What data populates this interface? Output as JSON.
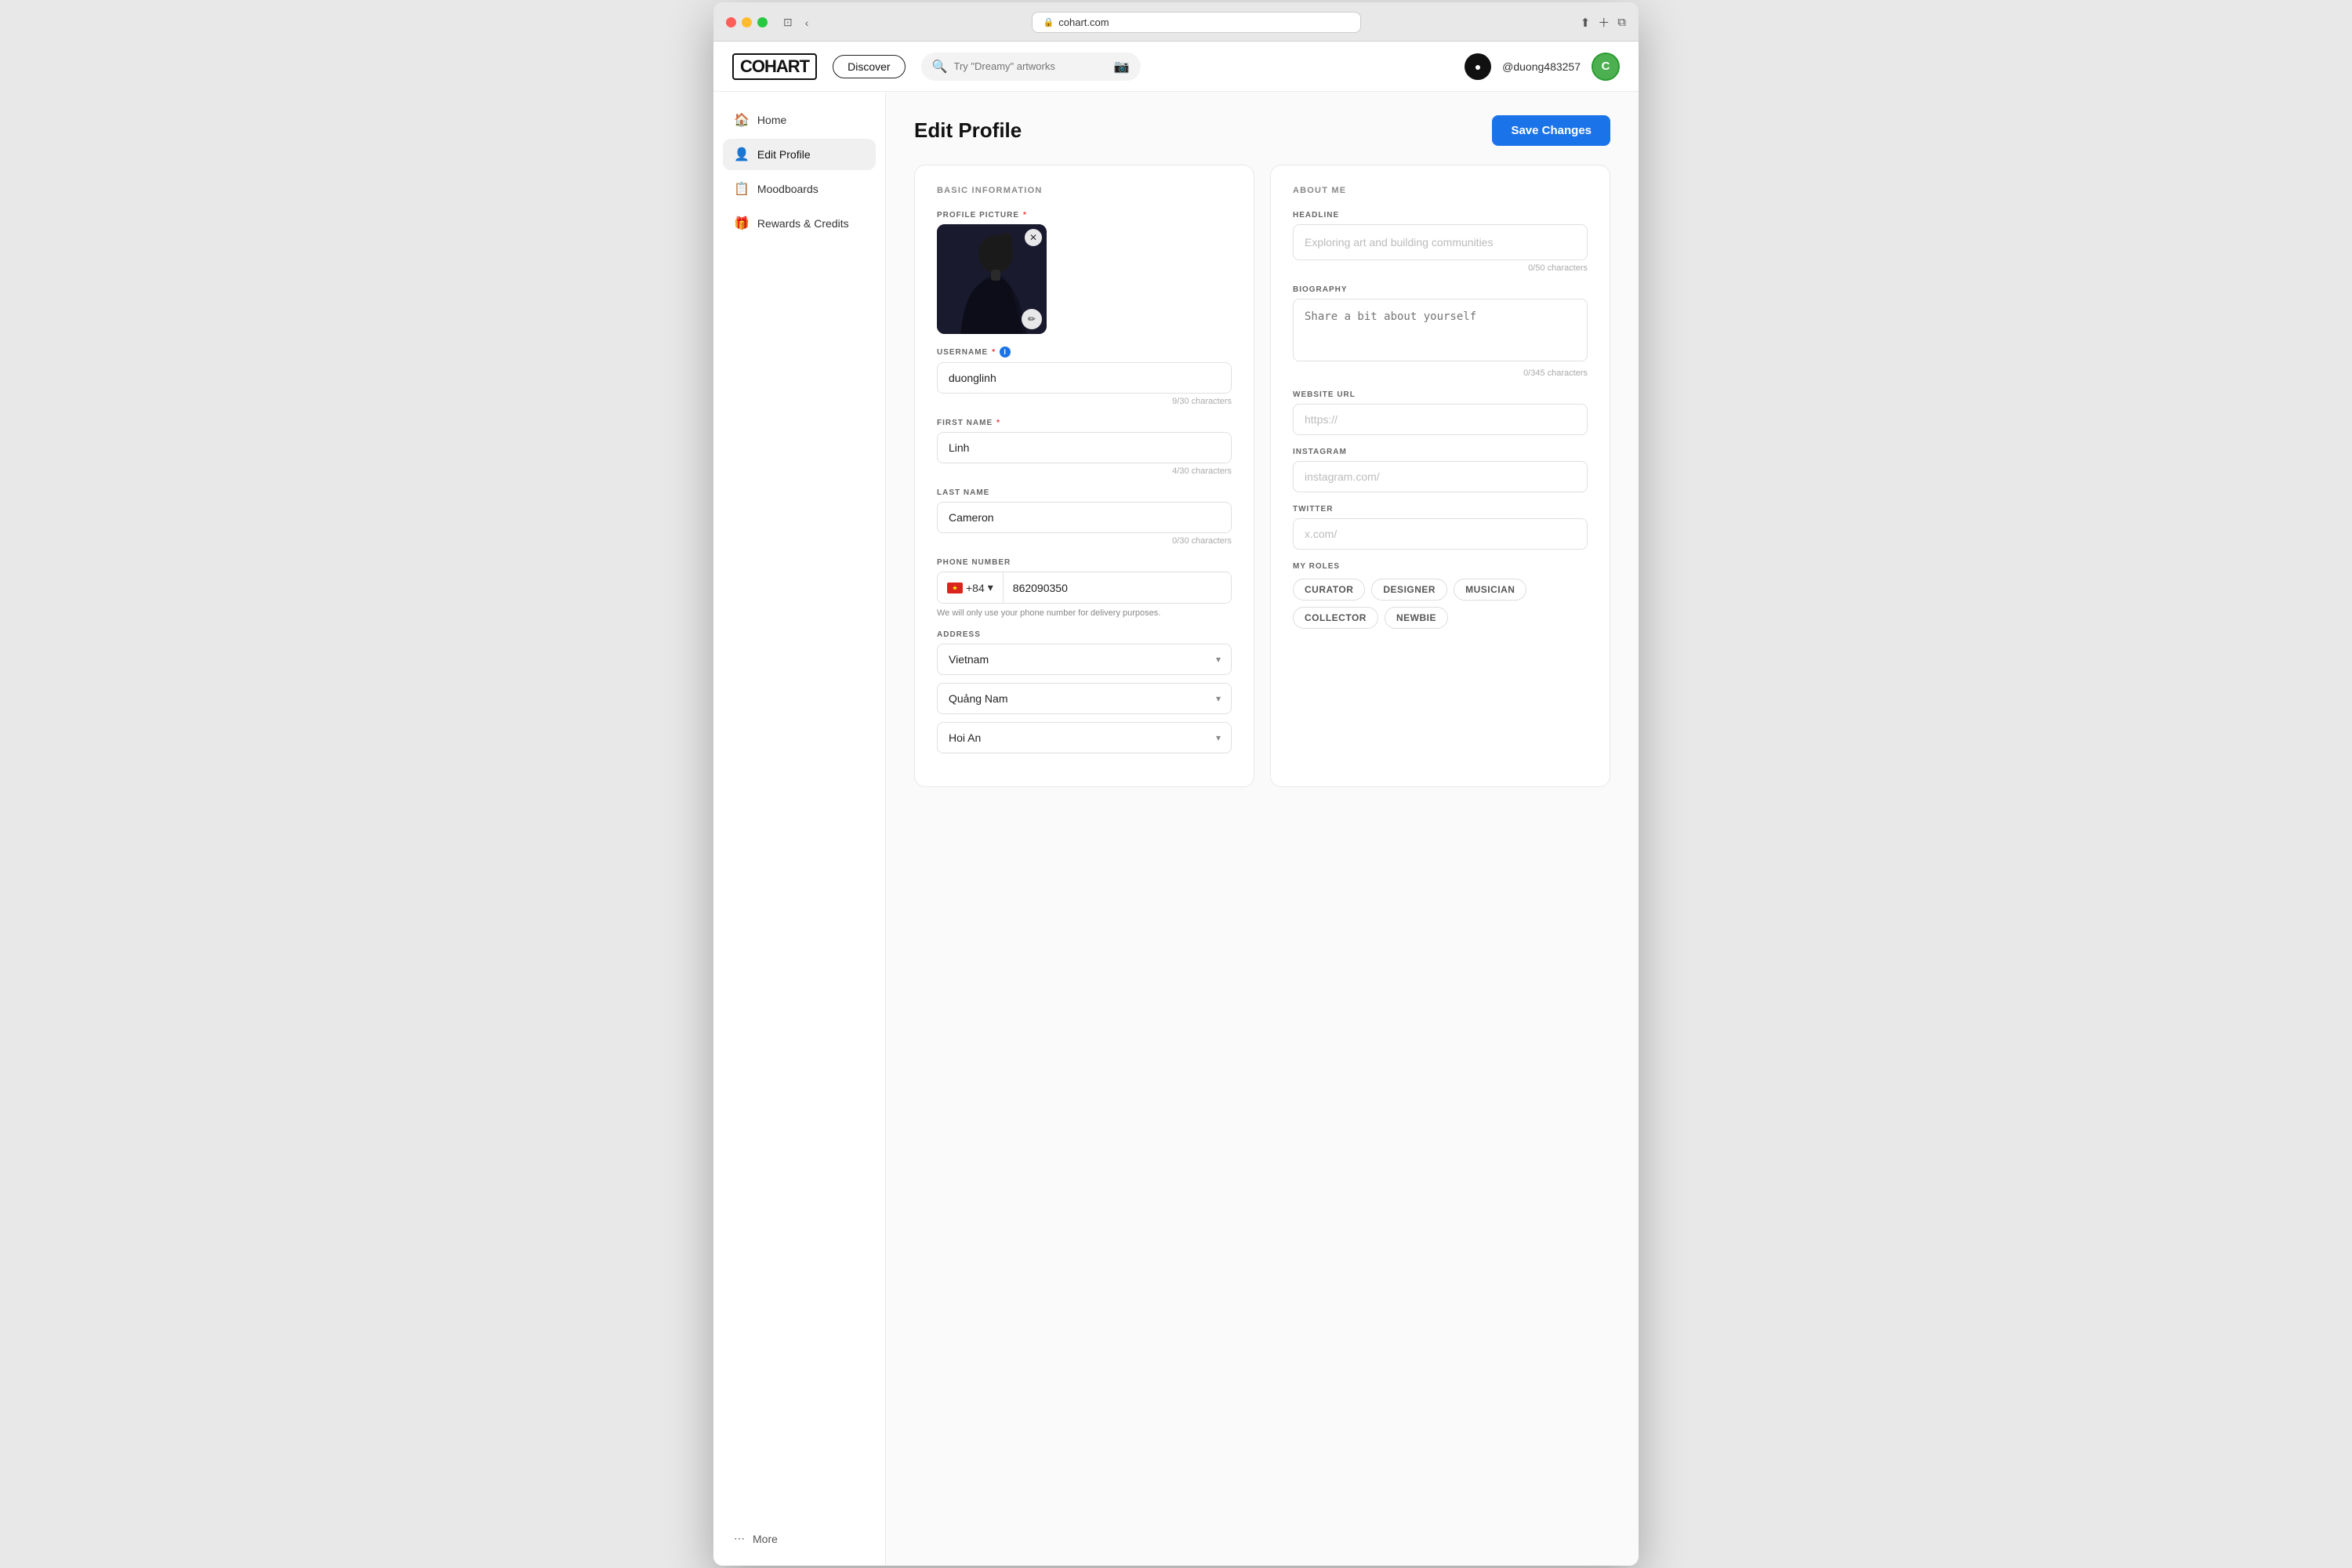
{
  "browser": {
    "url": "cohart.com",
    "url_icon": "🔒"
  },
  "navbar": {
    "logo": "COHART",
    "discover_label": "Discover",
    "search_placeholder": "Try \"Dreamy\" artworks",
    "username": "@duong483257",
    "avatar_initial": "C"
  },
  "sidebar": {
    "items": [
      {
        "id": "home",
        "label": "Home",
        "icon": "🏠"
      },
      {
        "id": "edit-profile",
        "label": "Edit Profile",
        "icon": "👤",
        "active": true
      },
      {
        "id": "moodboards",
        "label": "Moodboards",
        "icon": "📋"
      },
      {
        "id": "rewards",
        "label": "Rewards & Credits",
        "icon": "🎁"
      }
    ],
    "more_label": "More"
  },
  "page": {
    "title": "Edit Profile",
    "save_button_label": "Save Changes"
  },
  "basic_info": {
    "section_title": "BASIC INFORMATION",
    "profile_picture_label": "PROFILE PICTURE",
    "username_label": "USERNAME",
    "username_value": "duonglinh",
    "username_char_count": "9/30 characters",
    "first_name_label": "FIRST NAME",
    "first_name_value": "Linh",
    "first_name_char_count": "4/30 characters",
    "last_name_label": "LAST NAME",
    "last_name_value": "Cameron",
    "last_name_char_count": "0/30 characters",
    "phone_label": "PHONE NUMBER",
    "phone_prefix": "+84",
    "phone_value": "862090350",
    "phone_note": "We will only use your phone number for delivery purposes.",
    "address_label": "ADDRESS",
    "country_value": "Vietnam",
    "province_value": "Quảng Nam",
    "city_value": "Hoi An"
  },
  "about_me": {
    "section_title": "ABOUT ME",
    "headline_label": "HEADLINE",
    "headline_placeholder": "Exploring art and building communities",
    "headline_char_count": "0/50 characters",
    "bio_label": "BIOGRAPHY",
    "bio_placeholder": "Share a bit about yourself",
    "bio_char_count": "0/345 characters",
    "website_label": "WEBSITE URL",
    "website_placeholder": "https://",
    "instagram_label": "INSTAGRAM",
    "instagram_placeholder": "instagram.com/",
    "twitter_label": "TWITTER",
    "twitter_placeholder": "x.com/",
    "roles_label": "MY ROLES",
    "roles": [
      "CURATOR",
      "DESIGNER",
      "MUSICIAN",
      "COLLECTOR",
      "NEWBIE"
    ]
  }
}
